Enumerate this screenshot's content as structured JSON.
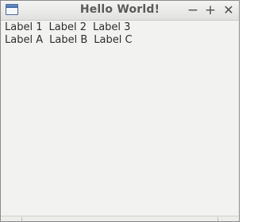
{
  "window": {
    "title": "Hello World!",
    "icons": {
      "app": "window-app-icon",
      "minimize": "minimize-icon",
      "maximize": "maximize-icon",
      "close": "close-icon"
    },
    "controls": {
      "minimize": "−",
      "maximize": "+",
      "close": "✕"
    }
  },
  "rows": [
    {
      "labels": [
        "Label 1",
        "Label 2",
        "Label 3"
      ]
    },
    {
      "labels": [
        "Label A",
        "Label B",
        "Label C"
      ]
    }
  ]
}
